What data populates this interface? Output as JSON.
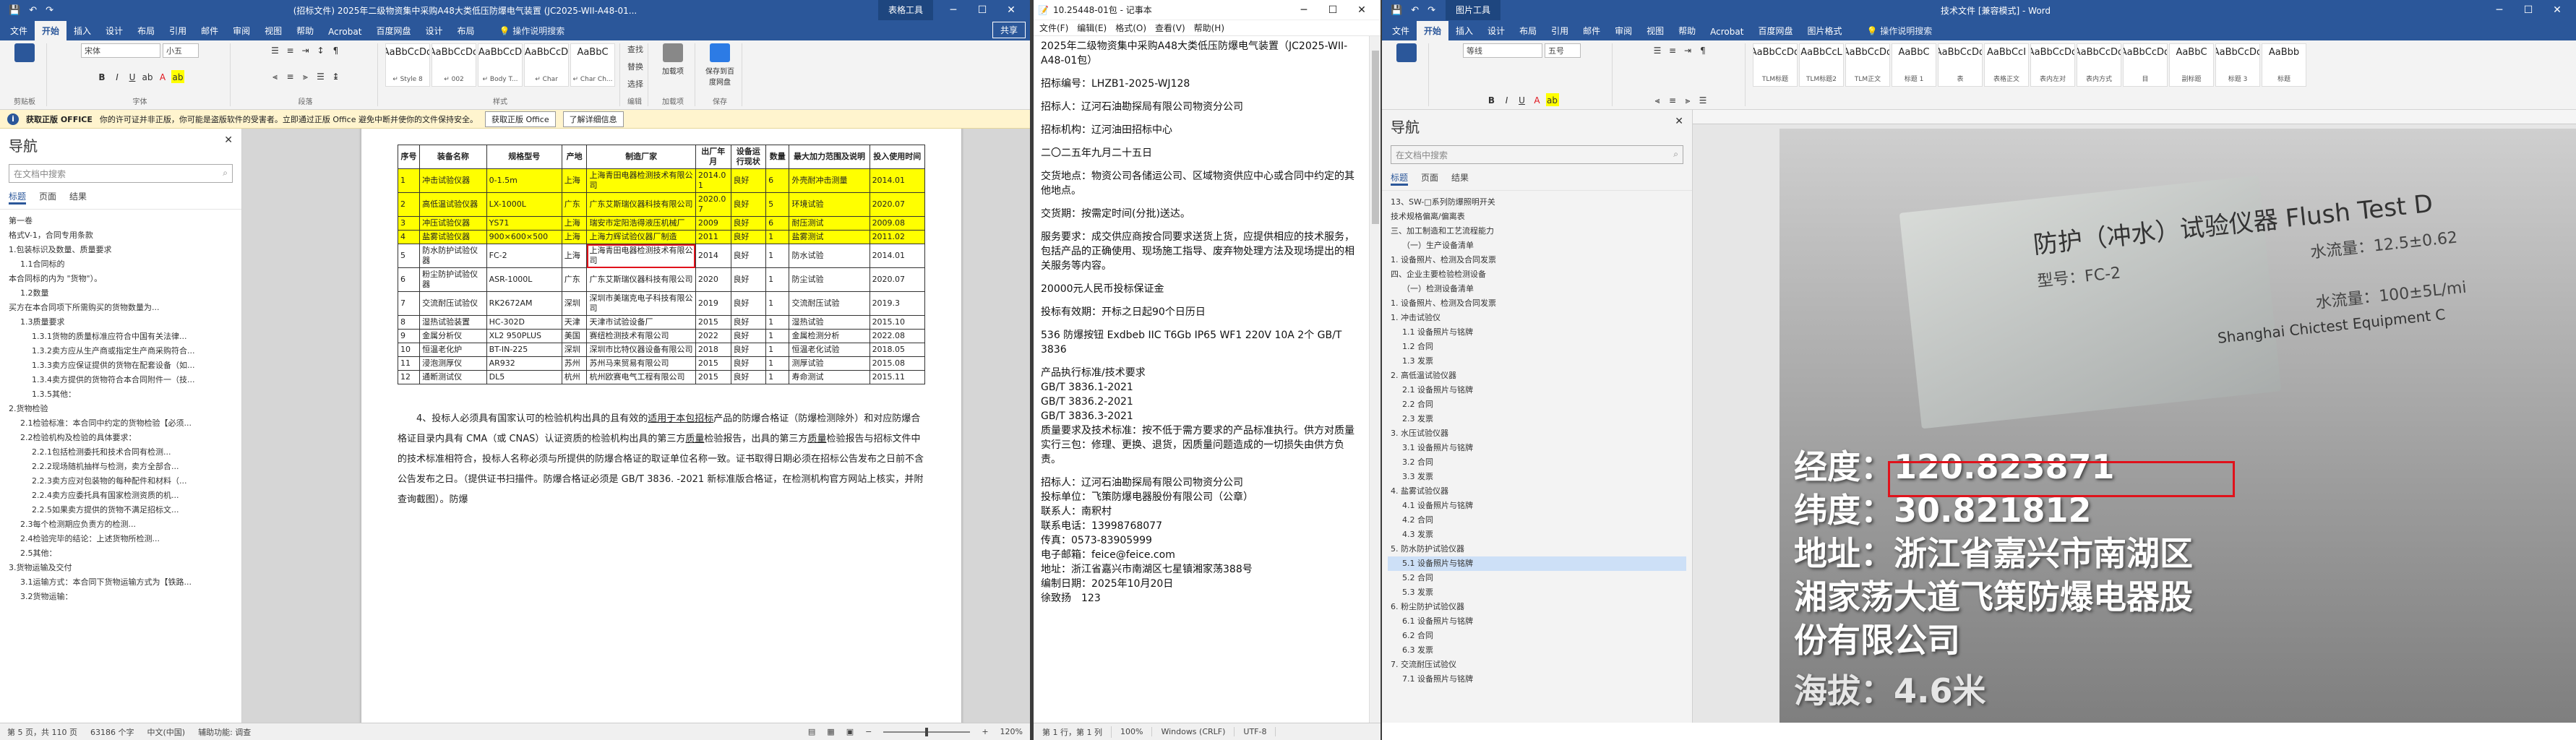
{
  "left_word": {
    "title": "(招标文件) 2025年二级物资集中采购A48大类低压防爆电气装置 (JC2025-WII-A48-01...",
    "context_tab": "表格工具",
    "tabs": [
      "文件",
      "开始",
      "插入",
      "设计",
      "布局",
      "引用",
      "邮件",
      "审阅",
      "视图",
      "帮助",
      "Acrobat",
      "百度网盘",
      "设计",
      "布局"
    ],
    "tell_me": "操作说明搜索",
    "share": "共享",
    "font_name": "宋体",
    "font_size": "小五",
    "styles": [
      {
        "preview": "AaBbCcDd",
        "name": "↵ Style 8"
      },
      {
        "preview": "AaBbCcDd",
        "name": "↵ 002"
      },
      {
        "preview": "AaBbCcD",
        "name": "↵ Body T..."
      },
      {
        "preview": "AaBbCcD",
        "name": "↵ Char"
      },
      {
        "preview": "AaBbC",
        "name": "↵ Char Ch..."
      }
    ],
    "buttons": {
      "find": "查找",
      "replace": "替换",
      "select": "选择",
      "addin": "加载项",
      "save_baidu": "保存到百度网盘"
    },
    "group_labels": {
      "clipboard": "剪贴板",
      "font": "字体",
      "paragraph": "段落",
      "styles": "样式",
      "edit": "编辑",
      "addin": "加载项",
      "save": "保存"
    },
    "msgbar": {
      "label": "获取正版 OFFICE",
      "text": "你的许可证并非正版，你可能是盗版软件的受害者。立即通过正版 Office 避免中断并使你的文件保持安全。",
      "btn1": "获取正版 Office",
      "btn2": "了解详细信息"
    },
    "nav": {
      "title": "导航",
      "search_placeholder": "在文档中搜索",
      "tabs": [
        "标题",
        "页面",
        "结果"
      ],
      "items": [
        "第一卷",
        "格式V-1，合同专用条款",
        "1.包装标识及数量、质量要求",
        "1.1合同标的",
        "本合同标的内为 \"货物\"）。",
        "1.2数量",
        "买方在本合同项下所需购买的货物数量为...",
        "1.3质量要求",
        "1.3.1货物的质量标准应符合中国有关法律...",
        "1.3.2卖方应从生产商或指定生产商采购符合...",
        "1.3.3卖方应保证提供的货物在配套设备（如...",
        "1.3.4卖方提供的货物符合本合同附件一（技...",
        "1.3.5其他：",
        "2.货物检验",
        "2.1检验标准：本合同中约定的货物检验【必须...",
        "2.2检验机构及检验的具体要求：",
        "2.2.1包括检测委托和技术合同有检测...",
        "2.2.2现场随机抽样与检测，卖方全部合...",
        "2.2.3卖方应对包装物的每种配件和材料（...",
        "2.2.4卖方应委托具有国家检测资质的机...",
        "2.2.5如果卖方提供的货物不满足招标文...",
        "2.3每个检测期应负责方的检测...",
        "2.4检验完毕的结论：上述货物所检测...",
        "2.5其他：",
        "3.货物运输及交付",
        "3.1运输方式：本合同下货物运输方式为【铁路...",
        "3.2货物运输："
      ]
    },
    "table": {
      "headers": [
        "序号",
        "装备名称",
        "规格型号",
        "产地",
        "制造厂家",
        "出厂年月",
        "设备运行现状",
        "数量",
        "最大加力范围及说明",
        "投入使用时间"
      ],
      "rows": [
        [
          "1",
          "冲击试验仪器",
          "0-1.5m",
          "上海",
          "上海青田电器检测技术有限公司",
          "2014.01",
          "良好",
          "6",
          "外壳耐冲击测量",
          "2014.01"
        ],
        [
          "2",
          "高低温试验仪器",
          "LX-1000L",
          "广东",
          "广东艾斯瑞仪器科技有限公司",
          "2020.07",
          "良好",
          "5",
          "环境试验",
          "2020.07"
        ],
        [
          "3",
          "冲压试验仪器",
          "YS71",
          "上海",
          "瑞安市定阳浩得液压机械厂",
          "2009",
          "良好",
          "6",
          "耐压测试",
          "2009.08"
        ],
        [
          "4",
          "盐雾试验仪器",
          "900×600×500",
          "上海",
          "上海力辉试验仪器厂制造",
          "2011",
          "良好",
          "1",
          "盐雾测试",
          "2011.02"
        ],
        [
          "5",
          "防水防护试验仪器",
          "FC-2",
          "上海",
          "上海青田电器检测技术有限公司",
          "2014",
          "良好",
          "1",
          "防水试验",
          "2014.01"
        ],
        [
          "6",
          "粉尘防护试验仪器",
          "ASR-1000L",
          "广东",
          "广东艾斯瑞仪器科技有限公司",
          "2020",
          "良好",
          "1",
          "防尘试验",
          "2020.07"
        ],
        [
          "7",
          "交流耐压试验仪",
          "RK2672AM",
          "深圳",
          "深圳市美瑞克电子科技有限公司",
          "2019",
          "良好",
          "1",
          "交流耐压试验",
          "2019.3"
        ],
        [
          "8",
          "湿热试验装置",
          "HC-302D",
          "天津",
          "天津市试验设备厂",
          "2015",
          "良好",
          "1",
          "湿热试验",
          "2015.10"
        ],
        [
          "9",
          "金属分析仪",
          "XL2 950PLUS",
          "美国",
          "赛纽检测技术有限公司",
          "2022",
          "良好",
          "1",
          "金属检测分析",
          "2022.08"
        ],
        [
          "10",
          "恒温老化炉",
          "BT-IN-225",
          "深圳",
          "深圳市比特仪器设备有限公司",
          "2018",
          "良好",
          "1",
          "恒温老化试验",
          "2018.05"
        ],
        [
          "11",
          "浸泡测厚仪",
          "AR932",
          "苏州",
          "苏州马来贸易有限公司",
          "2015",
          "良好",
          "1",
          "测厚试验",
          "2015.08"
        ],
        [
          "12",
          "通断测试仪",
          "DL5",
          "杭州",
          "杭州欧赛电气工程有限公司",
          "2015",
          "良好",
          "1",
          "寿命测试",
          "2015.11"
        ]
      ]
    },
    "paragraph": {
      "p1_a": "4、投标人必须具有国家认可的检验机构出具的且有效的",
      "p1_u1": "适用于本包招标",
      "p1_b": "产品的防爆合格证（防爆检测除外）和对应防爆合格证目录内具有 CMA（或 CNAS）认证资质的检验机构出具的第三方",
      "p1_u2": "质量",
      "p1_c": "检验报告，出具的第三方",
      "p1_u3": "质量",
      "p1_d": "检验报告与招标文件中的技术标准相符合，投标人名称必须与所提供的防爆合格证的取证单位名称一致。证书取得日期必须在招标公告发布之日前不含公告发布之日。（提供证书扫描件。防爆合格证必须是 GB/T 3836. -2021 新标准版合格证，在检测机构官方网站上核实，并附查询截图）。防爆"
    },
    "status": {
      "page": "第 5 页，共 110 页",
      "words": "63186 个字",
      "lang": "中文(中国)",
      "access": "辅助功能: 调查",
      "zoom": "120%"
    }
  },
  "notepad": {
    "title": "10.25448-01包 - 记事本",
    "menu": [
      "文件(F)",
      "编辑(E)",
      "格式(O)",
      "查看(V)",
      "帮助(H)"
    ],
    "lines": [
      "2025年二级物资集中采购A48大类低压防爆电气装置（JC2025-WII-A48-01包）",
      "招标编号：LHZB1-2025-WJ128",
      "招标人：辽河石油勘探局有限公司物资分公司",
      "招标机构：辽河油田招标中心",
      "二〇二五年九月二十五日",
      "交货地点：物资公司各储运公司、区域物资供应中心或合同中约定的其他地点。",
      "交货期：按需定时间(分批)送达。",
      "服务要求：成交供应商按合同要求送货上货，应提供相应的技术服务，包括产品的正确使用、现场施工指导、废弃物处理方法及现场提出的相关服务等内容。",
      "20000元人民币投标保证金",
      "投标有效期：开标之日起90个日历日",
      "536 防爆按钮 Exdbeb IIC T6Gb IP65 WF1 220V 10A 2个 GB/T 3836",
      "产品执行标准/技术要求",
      "GB/T 3836.1-2021",
      "GB/T 3836.2-2021",
      "GB/T 3836.3-2021",
      "质量要求及技术标准：按不低于需方要求的产品标准执行。供方对质量实行三包：修理、更换、退货，因质量问题造成的一切损失由供方负责。",
      "招标人：辽河石油勘探局有限公司物资分公司",
      "投标单位：飞策防爆电器股份有限公司（公章）",
      "联系人：南釈村",
      "联系电话：13998768077",
      "传真：0573-83905999",
      "电子邮箱：feice@feice.com",
      "地址：浙江省嘉兴市南湖区七星镇湘家荡388号",
      "编制日期：2025年10月20日",
      "徐致扬　123"
    ],
    "status": [
      "第 1 行，第 1 列",
      "100%",
      "Windows (CRLF)",
      "UTF-8"
    ]
  },
  "right_word": {
    "title": "技术文件 [兼容模式] - Word",
    "context_tab": "图片工具",
    "tabs": [
      "文件",
      "开始",
      "插入",
      "设计",
      "布局",
      "引用",
      "邮件",
      "审阅",
      "视图",
      "帮助",
      "Acrobat",
      "百度网盘",
      "图片格式"
    ],
    "tell_me": "操作说明搜索",
    "font_name": "等线",
    "font_size": "五号",
    "styles": [
      {
        "preview": "AaBbCcDd",
        "name": "TLM标题"
      },
      {
        "preview": "AaBbCcL",
        "name": "TLM标题2"
      },
      {
        "preview": "AaBbCcDd",
        "name": "TLM正文"
      },
      {
        "preview": "AaBbC",
        "name": "标题 1"
      },
      {
        "preview": "AaBbCcDd",
        "name": "表"
      },
      {
        "preview": "AaBbCcI",
        "name": "表格正文"
      },
      {
        "preview": "AaBbCcDd",
        "name": "表内左对"
      },
      {
        "preview": "AaBbCcDd",
        "name": "表内方式"
      },
      {
        "preview": "AaBbCcDd",
        "name": "目"
      },
      {
        "preview": "AaBbC",
        "name": "副标题"
      },
      {
        "preview": "AaBbCcDd",
        "name": "标题 3"
      },
      {
        "preview": "AaBbb",
        "name": "标题"
      }
    ],
    "nav": {
      "title": "导航",
      "search_placeholder": "在文档中搜索",
      "tabs": [
        "标题",
        "页面",
        "结果"
      ],
      "items": [
        "13、SW-□系列防爆照明开关",
        "技术规格偏离/偏离表",
        "三、加工制造和工艺流程能力",
        "（一）生产设备清单",
        "1. 设备照片、检测及合同发票",
        "四、企业主要检验检测设备",
        "（一）检测设备清单",
        "1. 设备照片、检测及合同发票",
        "1. 冲击试验仪",
        "1.1 设备照片与铭牌",
        "1.2 合同",
        "1.3 发票",
        "2. 高低温试验仪器",
        "2.1 设备照片与铭牌",
        "2.2 合同",
        "2.3 发票",
        "3. 水压试验仪器",
        "3.1 设备照片与铭牌",
        "3.2 合同",
        "3.3 发票",
        "4. 盐雾试验仪器",
        "4.1 设备照片与铭牌",
        "4.2 合同",
        "4.3 发票",
        "5. 防水防护试验仪器",
        "5.1 设备照片与铭牌",
        "5.2 合同",
        "5.3 发票",
        "6. 粉尘防护试验仪器",
        "6.1 设备照片与铭牌",
        "6.2 合同",
        "6.3 发票",
        "7. 交流耐压试验仪",
        "7.1 设备照片与铭牌"
      ]
    },
    "photo": {
      "plate_title": "防护（冲水）试验仪器 Flush Test D",
      "plate_model": "型号：FC-2",
      "plate_flow": "水流量：12.5±0.62",
      "plate_flow2": "水流量：100±5L/mi",
      "plate_maker": "Shanghai Chictest Equipment C",
      "overlay_lng": "经度：120.823871",
      "overlay_lat": "纬度：30.821812",
      "overlay_addr1": "地址：浙江省嘉兴市南湖区",
      "overlay_addr2": "湘家荡大道飞策防爆电器股",
      "overlay_addr3": "份有限公司",
      "overlay_alt": "海拔：4.6米"
    }
  },
  "colors": {
    "word_blue": "#2b579a",
    "highlight": "#ffff00",
    "mark_red": "#e0121b"
  }
}
